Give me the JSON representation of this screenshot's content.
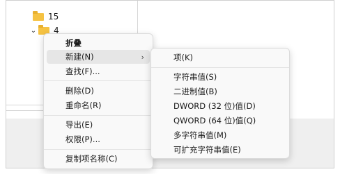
{
  "tree": {
    "items": [
      {
        "label": "15"
      },
      {
        "label": "4",
        "expanded": true
      }
    ]
  },
  "context_menu": {
    "items": [
      {
        "label": "折叠",
        "bold": true
      },
      {
        "label": "新建(N)",
        "submenu": true,
        "highlighted": true
      },
      {
        "label": "查找(F)..."
      },
      {
        "label": "删除(D)"
      },
      {
        "label": "重命名(R)"
      },
      {
        "label": "导出(E)"
      },
      {
        "label": "权限(P)..."
      },
      {
        "label": "复制项名称(C)"
      }
    ]
  },
  "new_submenu": {
    "items": [
      {
        "label": "项(K)"
      },
      {
        "label": "字符串值(S)"
      },
      {
        "label": "二进制值(B)"
      },
      {
        "label": "DWORD (32 位)值(D)"
      },
      {
        "label": "QWORD (64 位)值(Q)"
      },
      {
        "label": "多字符串值(M)"
      },
      {
        "label": "可扩充字符串值(E)"
      }
    ]
  },
  "icons": {
    "folder": "folder-icon",
    "expand": "chevron-down-icon",
    "submenu_arrow": "chevron-right-icon"
  }
}
